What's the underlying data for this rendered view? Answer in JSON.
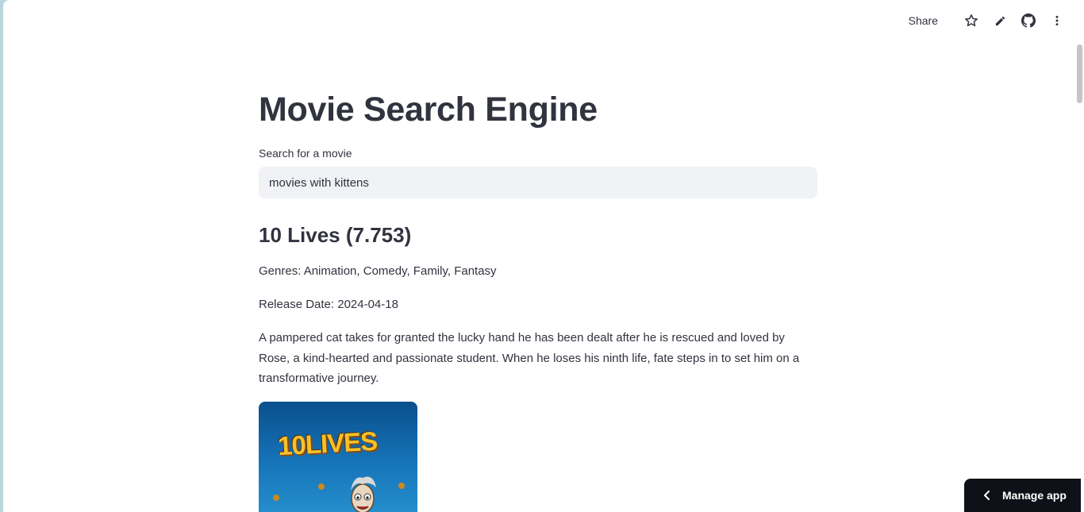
{
  "toolbar": {
    "share_label": "Share",
    "icons": [
      "star-icon",
      "pencil-icon",
      "github-icon",
      "more-vertical-icon"
    ]
  },
  "main": {
    "title": "Movie Search Engine",
    "search": {
      "label": "Search for a movie",
      "value": "movies with kittens"
    },
    "results": [
      {
        "title": "10 Lives (7.753)",
        "genres": "Genres: Animation, Comedy, Family, Fantasy",
        "release_date": "Release Date: 2024-04-18",
        "overview": "A pampered cat takes for granted the lucky hand he has been dealt after he is rescued and loved by Rose, a kind-hearted and passionate student. When he loses his ninth life, fate steps in to set him on a transformative journey.",
        "poster_text": "10LIVES"
      }
    ]
  },
  "manage_app": {
    "label": "Manage app"
  },
  "colors": {
    "text": "#31333f",
    "input_bg": "#f0f2f6",
    "manage_bg": "#0e1117",
    "outer_bg": "#b9d6dc"
  }
}
